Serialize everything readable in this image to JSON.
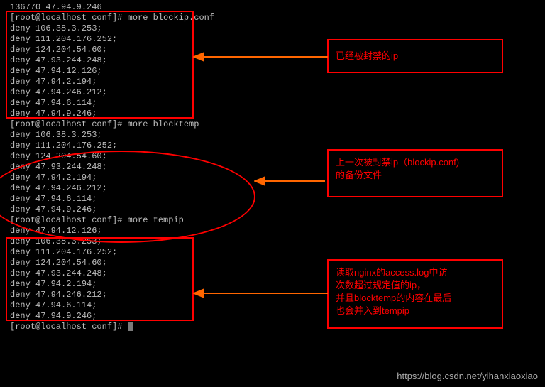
{
  "terminal": {
    "lines": [
      "136770 47.94.9.246",
      "[root@localhost conf]# more blockip.conf",
      "",
      "deny 106.38.3.253;",
      "deny 111.204.176.252;",
      "deny 124.204.54.60;",
      "deny 47.93.244.248;",
      "deny 47.94.12.126;",
      "deny 47.94.2.194;",
      "deny 47.94.246.212;",
      "deny 47.94.6.114;",
      "deny 47.94.9.246;",
      "[root@localhost conf]# more blocktemp",
      "",
      "deny 106.38.3.253;",
      "deny 111.204.176.252;",
      "deny 124.204.54.60;",
      "deny 47.93.244.248;",
      "deny 47.94.2.194;",
      "deny 47.94.246.212;",
      "deny 47.94.6.114;",
      "deny 47.94.9.246;",
      "[root@localhost conf]# more tempip",
      "deny 47.94.12.126;",
      "",
      "deny 106.38.3.253;",
      "deny 111.204.176.252;",
      "deny 124.204.54.60;",
      "deny 47.93.244.248;",
      "deny 47.94.2.194;",
      "deny 47.94.246.212;",
      "deny 47.94.6.114;",
      "deny 47.94.9.246;",
      "[root@localhost conf]# "
    ]
  },
  "annotations": {
    "a1": "已经被封禁的ip",
    "a2_line1": "上一次被封禁ip（blockip.conf)",
    "a2_line2": "的备份文件",
    "a3_line1": "读取nginx的access.log中访",
    "a3_line2": "次数超过规定值的ip，",
    "a3_line3": "并且blocktemp的内容在最后",
    "a3_line4": "也会并入到tempip"
  },
  "watermark": "https://blog.csdn.net/yihanxiaoxiao"
}
